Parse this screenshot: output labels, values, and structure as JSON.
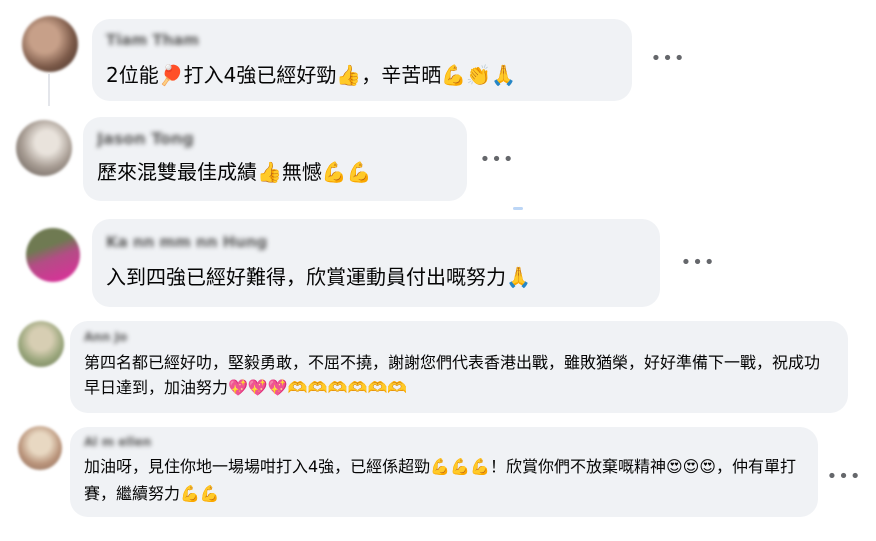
{
  "comments": [
    {
      "author": "Tiam Tham",
      "text": "2位能🏓打入4強已經好勁👍，辛苦晒💪👏🙏"
    },
    {
      "author": "Jason Tong",
      "text": "歷來混雙最佳成績👍無憾💪💪"
    },
    {
      "author": "Ka nn mm nn Hung",
      "text": "入到四強已經好難得，欣賞運動員付出嘅努力🙏"
    },
    {
      "author": "Ann Jo",
      "text": "第四名都已經好叻，堅毅勇敢，不屈不撓，謝謝您們代表香港出戰，雖敗猶榮，好好準備下一戰，祝成功早日達到，加油努力💖💖💖🫶🫶🫶🫶🫶🫶"
    },
    {
      "author": "Al m ellen",
      "text": "加油呀，見住你地一場場咁打入4強，已經係超勁💪💪💪！欣賞你們不放棄嘅精神😍😍😍，仲有單打賽，繼續努力💪💪"
    }
  ],
  "more_icon": "•••"
}
